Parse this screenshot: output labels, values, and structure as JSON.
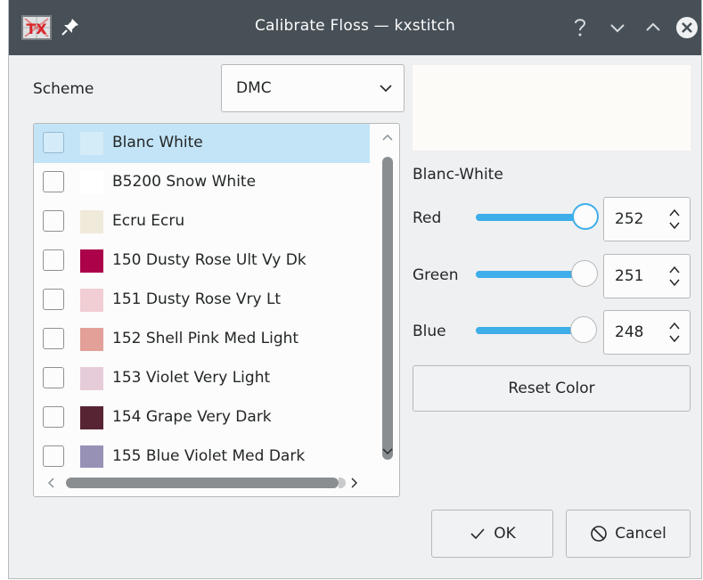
{
  "window": {
    "title": "Calibrate Floss — kxstitch",
    "app_icon_text": "TX"
  },
  "scheme": {
    "label": "Scheme",
    "selected": "DMC"
  },
  "floss_list": {
    "items": [
      {
        "label": "Blanc White",
        "color": "#d4ebf8",
        "selected": true
      },
      {
        "label": "B5200 Snow White",
        "color": "#ffffff",
        "selected": false
      },
      {
        "label": "Ecru Ecru",
        "color": "#f0eadb",
        "selected": false
      },
      {
        "label": "150 Dusty Rose Ult Vy Dk",
        "color": "#ab0249",
        "selected": false
      },
      {
        "label": "151 Dusty Rose Vry Lt",
        "color": "#f0ced4",
        "selected": false
      },
      {
        "label": "152 Shell Pink Med Light",
        "color": "#e2a099",
        "selected": false
      },
      {
        "label": "153 Violet Very Light",
        "color": "#e6ccd9",
        "selected": false
      },
      {
        "label": "154 Grape Very Dark",
        "color": "#572433",
        "selected": false
      },
      {
        "label": "155 Blue Violet Med Dark",
        "color": "#9891b6",
        "selected": false
      }
    ]
  },
  "calibration": {
    "preview_color": "#fcfbf8",
    "color_name": "Blanc-White",
    "red": {
      "label": "Red",
      "value": 252,
      "display": "252"
    },
    "green": {
      "label": "Green",
      "value": 251,
      "display": "251"
    },
    "blue": {
      "label": "Blue",
      "value": 248,
      "display": "248"
    },
    "max": 255
  },
  "buttons": {
    "reset": "Reset Color",
    "ok": "OK",
    "cancel": "Cancel"
  },
  "colors": {
    "accent": "#3daee9",
    "titlebar": "#475057",
    "selection": "#c3e4f7"
  },
  "icons": {
    "help": "question-mark-icon",
    "minimize": "chevron-down-icon",
    "maximize": "chevron-up-icon",
    "close": "close-icon",
    "ok": "checkmark-icon",
    "cancel": "cancel-icon"
  }
}
